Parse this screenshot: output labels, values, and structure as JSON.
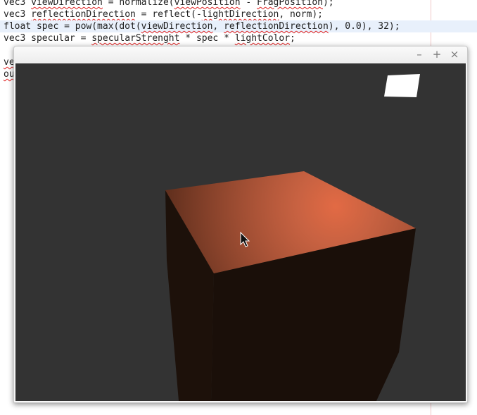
{
  "editor": {
    "lines": [
      {
        "parts": [
          {
            "t": "vec3 ",
            "s": false
          },
          {
            "t": "viewDirection",
            "s": true
          },
          {
            "t": " = normalize(",
            "s": false
          },
          {
            "t": "viewPosition",
            "s": true
          },
          {
            "t": " - ",
            "s": false
          },
          {
            "t": "FragPosition",
            "s": true
          },
          {
            "t": ");",
            "s": false
          }
        ]
      },
      {
        "parts": [
          {
            "t": "vec3 ",
            "s": false
          },
          {
            "t": "reflectionDirection",
            "s": true
          },
          {
            "t": " = reflect(-",
            "s": false
          },
          {
            "t": "lightDirection",
            "s": true
          },
          {
            "t": ", norm);",
            "s": false
          }
        ]
      },
      {
        "parts": [
          {
            "t": "float spec = pow(max(dot(",
            "s": false
          },
          {
            "t": "viewDirection",
            "s": true
          },
          {
            "t": ", ",
            "s": false
          },
          {
            "t": "reflectionDirection",
            "s": true
          },
          {
            "t": "), 0.0), 32);",
            "s": false
          }
        ]
      },
      {
        "parts": [
          {
            "t": "vec3 specular = ",
            "s": false
          },
          {
            "t": "specularStrenght",
            "s": true
          },
          {
            "t": " * spec * ",
            "s": false
          },
          {
            "t": "lightColor",
            "s": true
          },
          {
            "t": ";",
            "s": false
          }
        ]
      },
      {
        "parts": [
          {
            "t": "",
            "s": false
          }
        ]
      },
      {
        "parts": [
          {
            "t": "ve",
            "s": true
          }
        ]
      },
      {
        "parts": [
          {
            "t": "ou",
            "s": true
          }
        ]
      }
    ]
  },
  "window": {
    "minimize_icon": "–",
    "maximize_icon": "+",
    "close_icon": "×"
  },
  "scene": {
    "background": "#333333",
    "light_color": "#ffffff",
    "cube_top_color": "#5a2c1b",
    "cube_highlight_color": "#e26a44",
    "cube_left_face_color": "#1d110a",
    "cube_front_face_color": "#1a0f09"
  }
}
